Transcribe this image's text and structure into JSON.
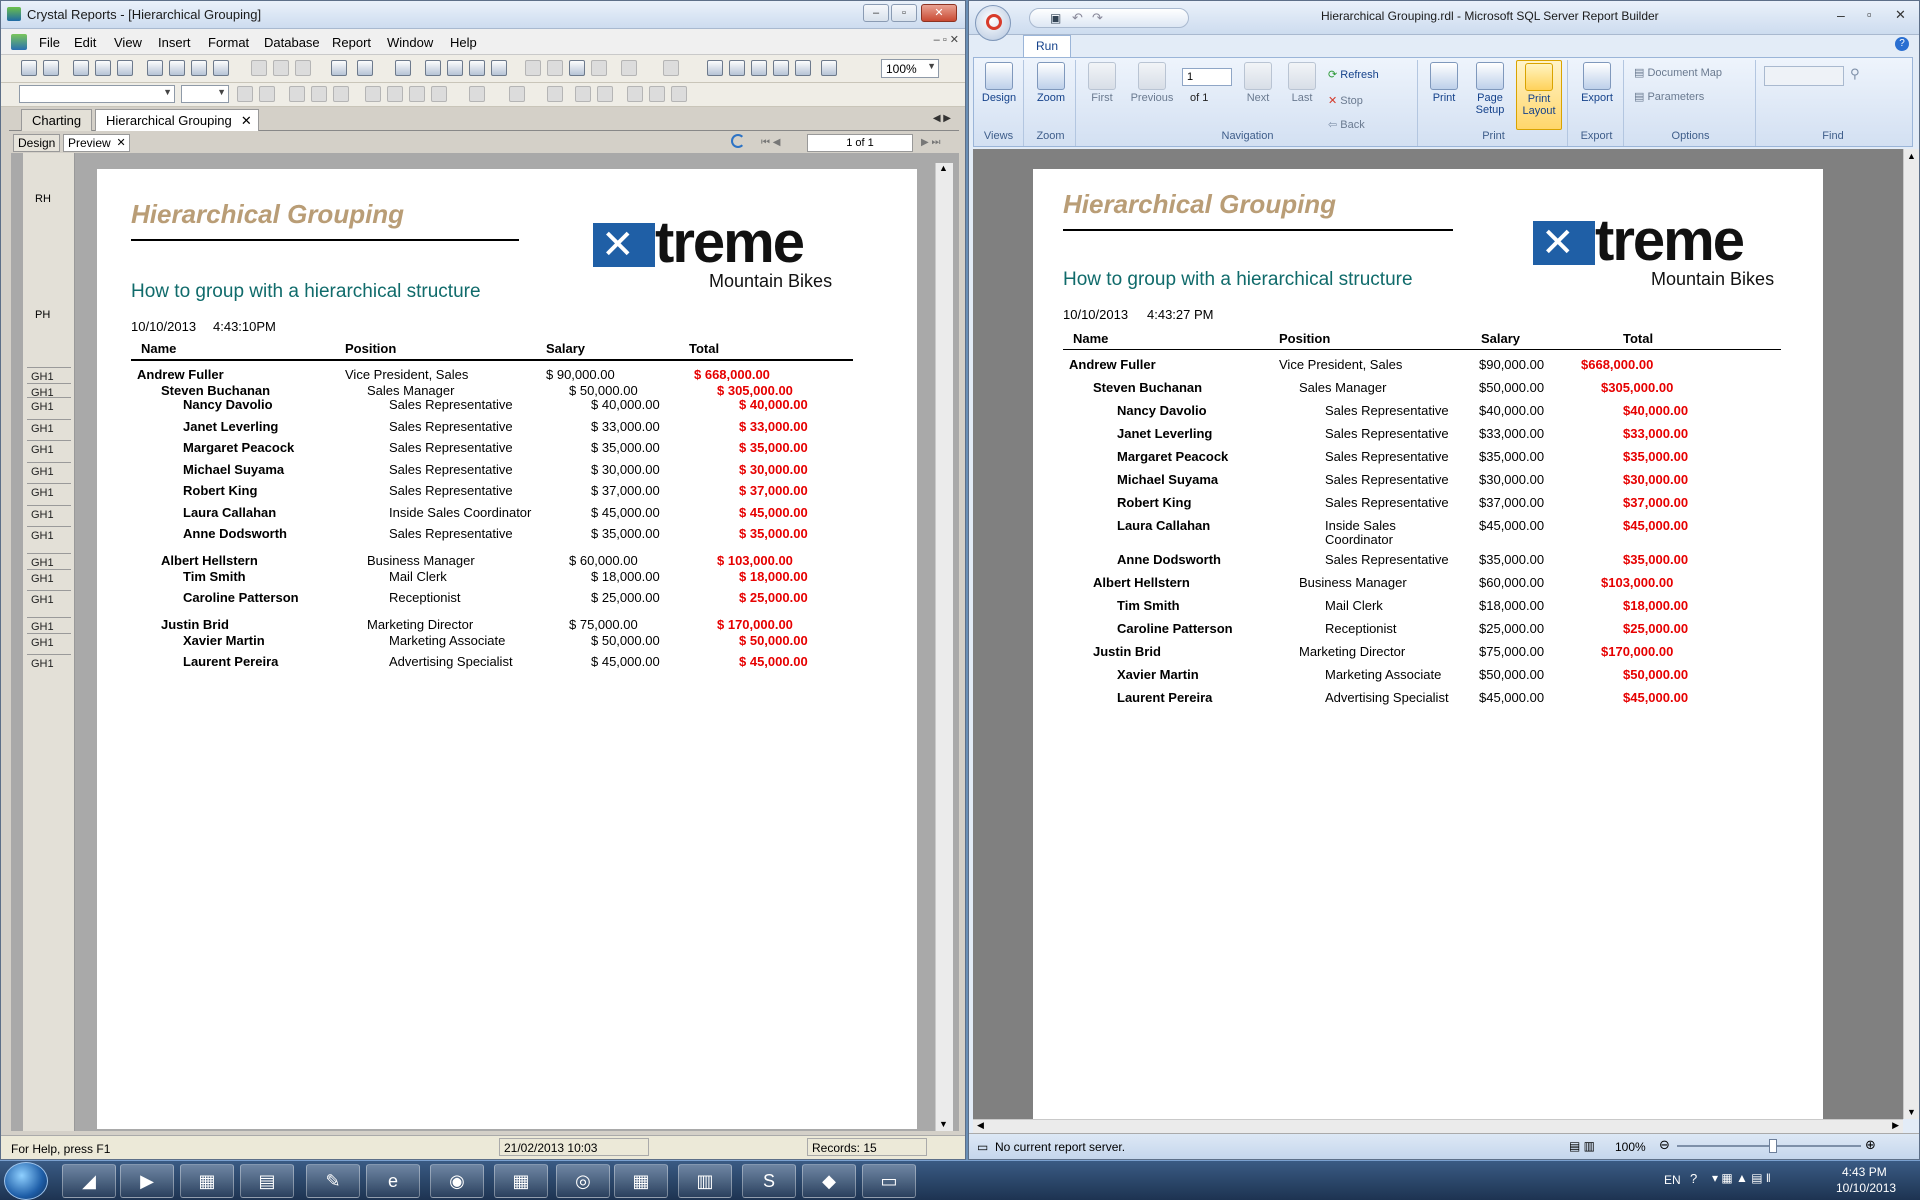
{
  "left": {
    "title": "Crystal Reports - [Hierarchical Grouping]",
    "menu": [
      "File",
      "Edit",
      "View",
      "Insert",
      "Format",
      "Database",
      "Report",
      "Window",
      "Help"
    ],
    "zoom": "100%",
    "tabs": [
      "Charting",
      "Hierarchical Grouping"
    ],
    "subtabs": [
      "Design",
      "Preview"
    ],
    "page_nav": "1 of 1",
    "section_labels": [
      "RH",
      "PH"
    ],
    "group_label": "GH1",
    "status": {
      "help": "For Help, press F1",
      "date": "21/02/2013  10:03",
      "records": "Records:  15"
    },
    "report": {
      "date": "10/10/2013",
      "time": "4:43:10PM"
    }
  },
  "right": {
    "title": "Hierarchical Grouping.rdl - Microsoft SQL Server Report Builder",
    "ribbon_tab": "Run",
    "groups": {
      "views": "Views",
      "zoom": "Zoom",
      "navigation": "Navigation",
      "print": "Print",
      "export": "Export",
      "options": "Options",
      "find": "Find"
    },
    "buttons": {
      "design": "Design",
      "zoom": "Zoom",
      "first": "First",
      "previous": "Previous",
      "next": "Next",
      "last": "Last",
      "refresh": "Refresh",
      "stop": "Stop",
      "back": "Back",
      "print": "Print",
      "page_setup_1": "Page",
      "page_setup_2": "Setup",
      "print_layout_1": "Print",
      "print_layout_2": "Layout",
      "export": "Export",
      "document_map": "Document Map",
      "parameters": "Parameters"
    },
    "page_num": "1",
    "of_pages": "of  1",
    "status": {
      "server": "No current report server.",
      "zoom": "100%"
    },
    "report": {
      "date": "10/10/2013",
      "time": "4:43:27 PM"
    }
  },
  "report": {
    "title": "Hierarchical Grouping",
    "subtitle": "How to group with a hierarchical structure",
    "logo_word": "treme",
    "logo_sub": "Mountain Bikes",
    "headers": {
      "name": "Name",
      "position": "Position",
      "salary": "Salary",
      "total": "Total"
    },
    "rows": [
      {
        "level": 0,
        "name": "Andrew Fuller",
        "position": "Vice President, Sales",
        "salary_l": "$ 90,000.00",
        "total_l": "$ 668,000.00",
        "salary_r": "$90,000.00",
        "total_r": "$668,000.00"
      },
      {
        "level": 1,
        "name": "Steven Buchanan",
        "position": "Sales Manager",
        "salary_l": "$ 50,000.00",
        "total_l": "$ 305,000.00",
        "salary_r": "$50,000.00",
        "total_r": "$305,000.00"
      },
      {
        "level": 2,
        "name": "Nancy Davolio",
        "position": "Sales Representative",
        "salary_l": "$ 40,000.00",
        "total_l": "$ 40,000.00",
        "salary_r": "$40,000.00",
        "total_r": "$40,000.00"
      },
      {
        "level": 2,
        "name": "Janet Leverling",
        "position": "Sales Representative",
        "salary_l": "$ 33,000.00",
        "total_l": "$ 33,000.00",
        "salary_r": "$33,000.00",
        "total_r": "$33,000.00"
      },
      {
        "level": 2,
        "name": "Margaret Peacock",
        "position": "Sales Representative",
        "salary_l": "$ 35,000.00",
        "total_l": "$ 35,000.00",
        "salary_r": "$35,000.00",
        "total_r": "$35,000.00"
      },
      {
        "level": 2,
        "name": "Michael Suyama",
        "position": "Sales Representative",
        "salary_l": "$ 30,000.00",
        "total_l": "$ 30,000.00",
        "salary_r": "$30,000.00",
        "total_r": "$30,000.00"
      },
      {
        "level": 2,
        "name": "Robert King",
        "position": "Sales Representative",
        "salary_l": "$ 37,000.00",
        "total_l": "$ 37,000.00",
        "salary_r": "$37,000.00",
        "total_r": "$37,000.00"
      },
      {
        "level": 2,
        "name": "Laura Callahan",
        "position": "Inside Sales Coordinator",
        "salary_l": "$ 45,000.00",
        "total_l": "$ 45,000.00",
        "salary_r": "$45,000.00",
        "total_r": "$45,000.00"
      },
      {
        "level": 2,
        "name": "Anne Dodsworth",
        "position": "Sales Representative",
        "salary_l": "$ 35,000.00",
        "total_l": "$ 35,000.00",
        "salary_r": "$35,000.00",
        "total_r": "$35,000.00"
      },
      {
        "level": 1,
        "name": "Albert Hellstern",
        "position": "Business Manager",
        "salary_l": "$ 60,000.00",
        "total_l": "$ 103,000.00",
        "salary_r": "$60,000.00",
        "total_r": "$103,000.00"
      },
      {
        "level": 2,
        "name": "Tim Smith",
        "position": "Mail Clerk",
        "salary_l": "$ 18,000.00",
        "total_l": "$ 18,000.00",
        "salary_r": "$18,000.00",
        "total_r": "$18,000.00"
      },
      {
        "level": 2,
        "name": "Caroline Patterson",
        "position": "Receptionist",
        "salary_l": "$ 25,000.00",
        "total_l": "$ 25,000.00",
        "salary_r": "$25,000.00",
        "total_r": "$25,000.00"
      },
      {
        "level": 1,
        "name": "Justin Brid",
        "position": "Marketing Director",
        "salary_l": "$ 75,000.00",
        "total_l": "$ 170,000.00",
        "salary_r": "$75,000.00",
        "total_r": "$170,000.00"
      },
      {
        "level": 2,
        "name": "Xavier Martin",
        "position": "Marketing Associate",
        "salary_l": "$ 50,000.00",
        "total_l": "$ 50,000.00",
        "salary_r": "$50,000.00",
        "total_r": "$50,000.00"
      },
      {
        "level": 2,
        "name": "Laurent Pereira",
        "position": "Advertising Specialist",
        "salary_l": "$ 45,000.00",
        "total_l": "$ 45,000.00",
        "salary_r": "$45,000.00",
        "total_r": "$45,000.00"
      }
    ],
    "coordinator_split": [
      "Inside Sales",
      "Coordinator"
    ]
  },
  "taskbar": {
    "lang": "EN",
    "time": "4:43 PM",
    "date": "10/10/2013"
  },
  "colors": {
    "title": "#b99d76",
    "subtitle": "#106b6b",
    "total": "#e60000",
    "logo_blue": "#1f5fa6"
  }
}
